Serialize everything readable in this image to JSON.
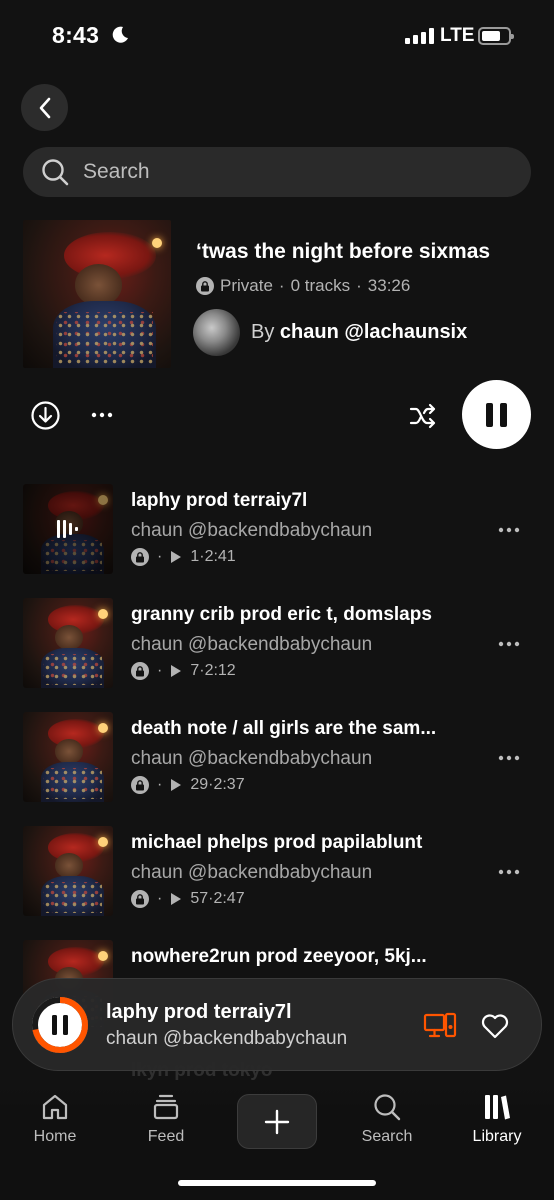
{
  "status_bar": {
    "time": "8:43",
    "network": "LTE"
  },
  "search": {
    "placeholder": "Search"
  },
  "playlist": {
    "title": "‘twas the night before sixmas",
    "privacy": "Private",
    "separator": "·",
    "track_count": "0 tracks",
    "duration": "33:26",
    "by_label": "By",
    "owner": "chaun @lachaunsix"
  },
  "tracks": [
    {
      "title": "laphy prod terraiy7l",
      "artist": "chaun @backendbabychaun",
      "plays": "1",
      "duration": "2:41",
      "now_playing": true
    },
    {
      "title": "granny crib prod eric t, domslaps",
      "artist": "chaun @backendbabychaun",
      "plays": "7",
      "duration": "2:12",
      "now_playing": false
    },
    {
      "title": "death note / all girls are the sam...",
      "artist": "chaun @backendbabychaun",
      "plays": "29",
      "duration": "2:37",
      "now_playing": false
    },
    {
      "title": "michael phelps prod papilablunt",
      "artist": "chaun @backendbabychaun",
      "plays": "57",
      "duration": "2:47",
      "now_playing": false
    },
    {
      "title": "nowhere2run prod zeeyoor, 5kj...",
      "artist": "",
      "plays": "",
      "duration": "",
      "now_playing": false
    }
  ],
  "faded_text": "lkyn prod tokyo",
  "mini_player": {
    "title": "laphy prod terraiy7l",
    "artist": "chaun @backendbabychaun",
    "progress": 0.72,
    "accent_color": "#ff5500"
  },
  "tab_bar": {
    "items": [
      {
        "label": "Home",
        "icon": "home-icon"
      },
      {
        "label": "Feed",
        "icon": "feed-icon"
      },
      {
        "label": "Search",
        "icon": "search-icon"
      },
      {
        "label": "Library",
        "icon": "library-icon",
        "active": true
      }
    ]
  },
  "colors": {
    "background": "#121212",
    "accent": "#ff5500"
  }
}
